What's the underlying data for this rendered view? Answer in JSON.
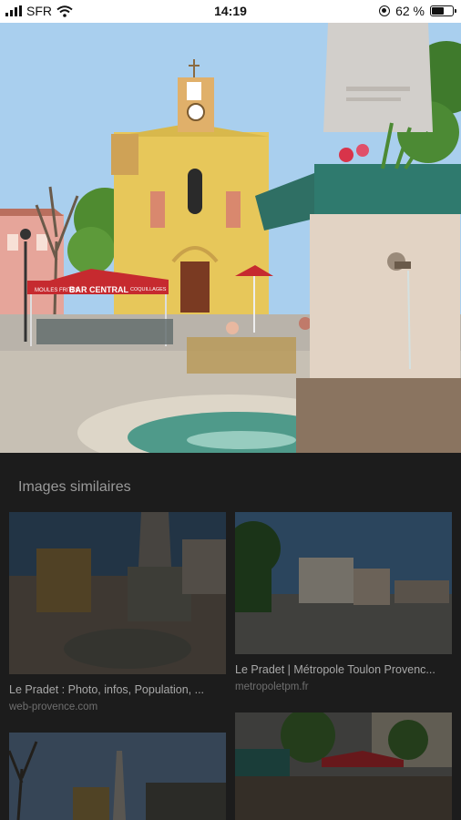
{
  "status_bar": {
    "carrier": "SFR",
    "time": "14:19",
    "battery_percent": "62 %",
    "battery_level": 0.62,
    "icons": [
      "signal-bars-icon",
      "wifi-icon",
      "rotation-lock-icon",
      "battery-icon"
    ]
  },
  "main_image": {
    "signs": {
      "bar_name": "BAR CENTRAL",
      "sign_left": "MOULES FRITES",
      "sign_right": "COQUILLAGES"
    }
  },
  "similar": {
    "heading": "Images similaires",
    "items": [
      {
        "title": "Le Pradet : Photo, infos, Population, ...",
        "source": "web-provence.com"
      },
      {
        "title": "Le Pradet | Métropole Toulon Provenc...",
        "source": "metropoletpm.fr"
      },
      {
        "title": "",
        "source": ""
      },
      {
        "title": "",
        "source": ""
      }
    ]
  },
  "colors": {
    "overlay_background": "#1c1c1c",
    "sky": "#a9cfee",
    "chapel": "#e7c75a",
    "awning": "#c62a2f"
  }
}
